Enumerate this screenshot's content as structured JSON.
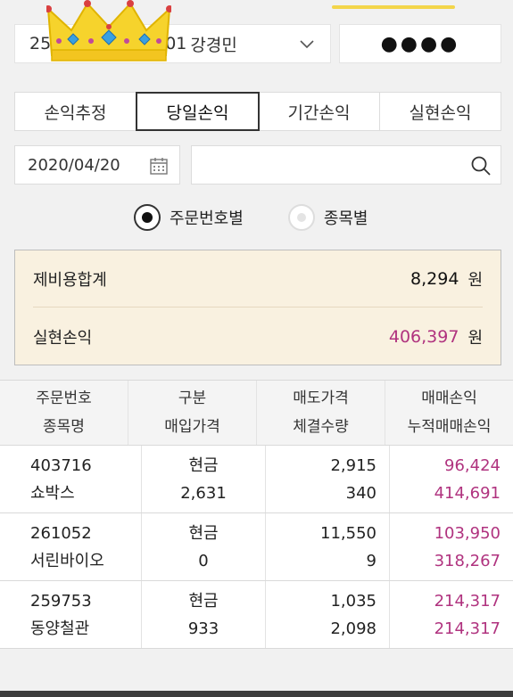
{
  "header": {
    "account_prefix": "25",
    "account_suffix": "01",
    "account_name": "강경민",
    "password_mask": "●●●●"
  },
  "tabs": [
    {
      "label": "손익추정",
      "active": false
    },
    {
      "label": "당일손익",
      "active": true
    },
    {
      "label": "기간손익",
      "active": false
    },
    {
      "label": "실현손익",
      "active": false
    }
  ],
  "filters": {
    "date": "2020/04/20",
    "search_placeholder": "",
    "radio_order": "주문번호별",
    "radio_stock": "종목별"
  },
  "summary": {
    "fee_label": "제비용합계",
    "fee_value": "8,294",
    "realized_label": "실현손익",
    "realized_value": "406,397",
    "unit": "원"
  },
  "table": {
    "headers": [
      [
        "주문번호",
        "종목명"
      ],
      [
        "구분",
        "매입가격"
      ],
      [
        "매도가격",
        "체결수량"
      ],
      [
        "매매손익",
        "누적매매손익"
      ]
    ],
    "rows": [
      {
        "order": "403716",
        "name": "쇼박스",
        "type": "현금",
        "buy": "2,631",
        "sell": "2,915",
        "qty": "340",
        "pnl": "96,424",
        "cum": "414,691"
      },
      {
        "order": "261052",
        "name": "서린바이오",
        "type": "현금",
        "buy": "0",
        "sell": "11,550",
        "qty": "9",
        "pnl": "103,950",
        "cum": "318,267"
      },
      {
        "order": "259753",
        "name": "동양철관",
        "type": "현금",
        "buy": "933",
        "sell": "1,035",
        "qty": "2,098",
        "pnl": "214,317",
        "cum": "214,317"
      }
    ]
  },
  "colors": {
    "accent_yellow": "#f3d54a",
    "profit_pink": "#b0337f",
    "summary_bg": "#f9f1e0"
  },
  "icons": [
    "crown-icon",
    "chevron-down-icon",
    "calendar-icon",
    "search-icon"
  ]
}
